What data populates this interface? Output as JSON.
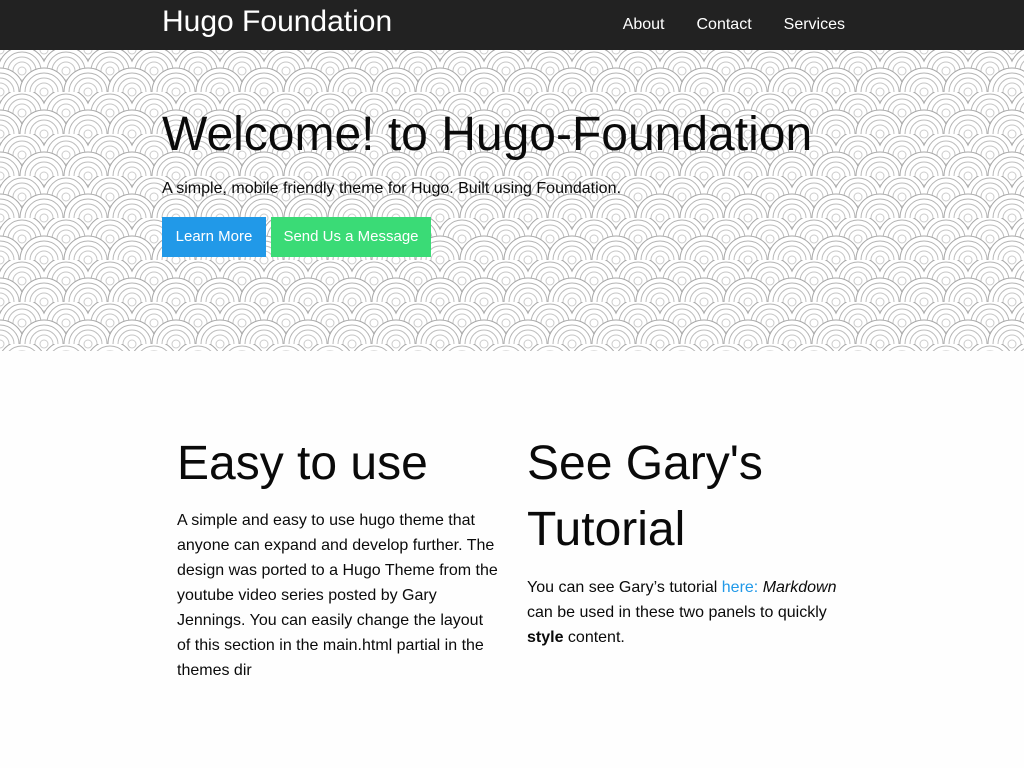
{
  "header": {
    "brand": "Hugo Foundation",
    "nav": [
      "About",
      "Contact",
      "Services"
    ]
  },
  "hero": {
    "title": "Welcome! to Hugo-Foundation",
    "subtitle": "A simple, mobile friendly theme for Hugo. Built using Foundation.",
    "primary_button": "Learn More",
    "secondary_button": "Send Us a Message"
  },
  "panels": [
    {
      "title": "Easy to use",
      "body": "A simple and easy to use hugo theme that anyone can expand and develop further. The design was ported to a Hugo Theme from the youtube video series posted by Gary Jennings. You can easily change the layout of this section in the main.html partial in the themes dir"
    },
    {
      "title": "See Gary's Tutorial",
      "body_prefix": "You can see Gary’s tutorial ",
      "link": "here:",
      "space": " ",
      "emphasis": "Markdown",
      "body_middle": " can be used in these two panels to quickly ",
      "strong": "style",
      "body_suffix": " content."
    }
  ],
  "colors": {
    "topbar": "#222222",
    "primary": "#2199e8",
    "success": "#3adb76",
    "link": "#2199e8"
  }
}
